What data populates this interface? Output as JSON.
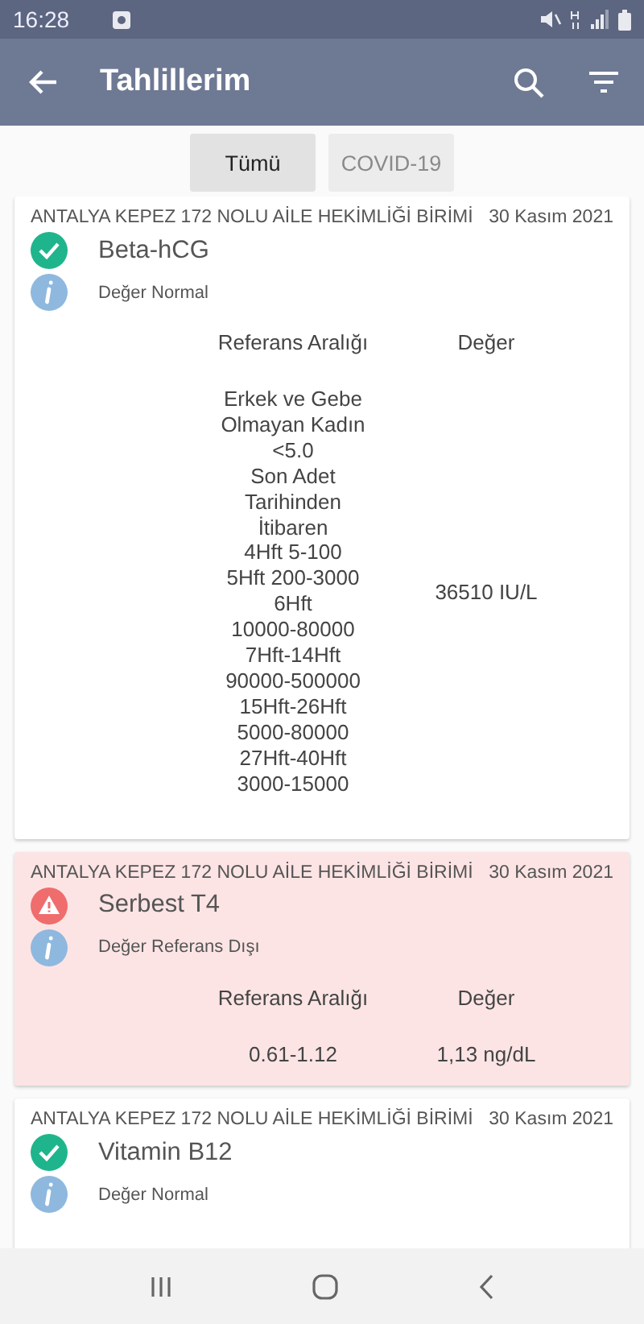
{
  "status_bar": {
    "time": "16:28"
  },
  "app_bar": {
    "title": "Tahlillerim"
  },
  "tabs": [
    {
      "label": "Tümü",
      "selected": true
    },
    {
      "label": "COVID-19",
      "selected": false
    }
  ],
  "results": [
    {
      "institution": "ANTALYA KEPEZ 172 NOLU AİLE HEKİMLİĞİ BİRİMİ",
      "date": "30 Kasım 2021",
      "test": "Beta-hCG",
      "kind": "normal",
      "note": "Değer Normal",
      "ref_header": "Referans Aralığı",
      "value_header": "Değer",
      "reference_lines": [
        "Erkek ve Gebe",
        "Olmayan Kadın",
        "<5.0",
        "Son Adet",
        "Tarihinden",
        "İtibaren",
        "4Hft 5-100",
        "5Hft 200-3000",
        "6Hft",
        "10000-80000",
        "7Hft-14Hft",
        "90000-500000",
        "15Hft-26Hft",
        "5000-80000",
        "27Hft-40Hft",
        "3000-15000"
      ],
      "value": "36510 IU/L"
    },
    {
      "institution": "ANTALYA KEPEZ 172 NOLU AİLE HEKİMLİĞİ BİRİMİ",
      "date": "30 Kasım 2021",
      "test": "Serbest T4",
      "kind": "abnormal",
      "note": "Değer Referans Dışı",
      "ref_header": "Referans Aralığı",
      "value_header": "Değer",
      "reference_lines": [
        "0.61-1.12"
      ],
      "value": "1,13 ng/dL"
    },
    {
      "institution": "ANTALYA KEPEZ 172 NOLU AİLE HEKİMLİĞİ BİRİMİ",
      "date": "30 Kasım 2021",
      "test": "Vitamin B12",
      "kind": "normal",
      "note": "Değer Normal"
    }
  ]
}
